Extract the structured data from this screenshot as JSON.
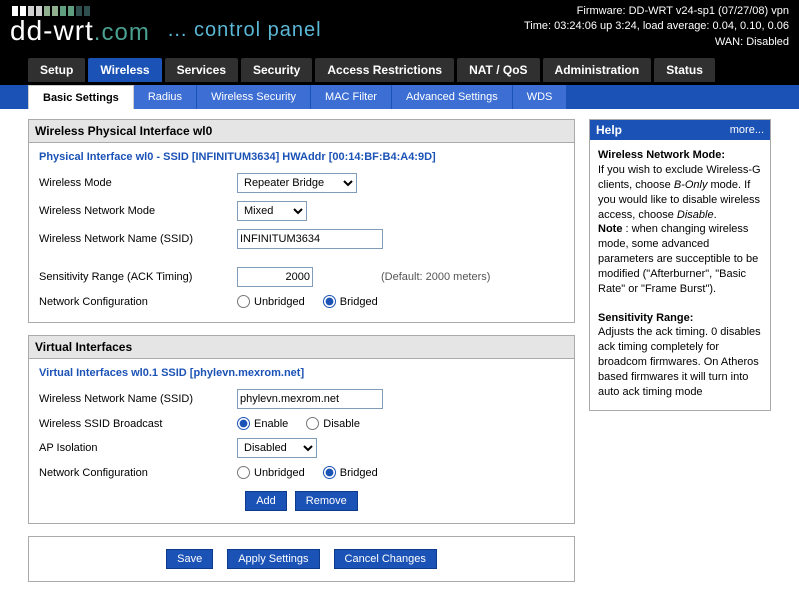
{
  "header": {
    "firmware": "Firmware: DD-WRT v24-sp1 (07/27/08) vpn",
    "time": "Time: 03:24:06 up 3:24, load average: 0.04, 0.10, 0.06",
    "wan": "WAN: Disabled",
    "control_panel": "... control panel"
  },
  "primary_tabs": [
    "Setup",
    "Wireless",
    "Services",
    "Security",
    "Access Restrictions",
    "NAT / QoS",
    "Administration",
    "Status"
  ],
  "primary_active": 1,
  "sub_tabs": [
    "Basic Settings",
    "Radius",
    "Wireless Security",
    "MAC Filter",
    "Advanced Settings",
    "WDS"
  ],
  "sub_active": 0,
  "phys": {
    "panel_title": "Wireless Physical Interface wl0",
    "section": "Physical Interface wl0 - SSID [INFINITUM3634] HWAddr [00:14:BF:B4:A4:9D]",
    "mode_label": "Wireless Mode",
    "mode_value": "Repeater Bridge",
    "netmode_label": "Wireless Network Mode",
    "netmode_value": "Mixed",
    "ssid_label": "Wireless Network Name (SSID)",
    "ssid_value": "INFINITUM3634",
    "ack_label": "Sensitivity Range (ACK Timing)",
    "ack_value": "2000",
    "ack_hint": "(Default: 2000 meters)",
    "netcfg_label": "Network Configuration",
    "unbridged": "Unbridged",
    "bridged": "Bridged"
  },
  "virt": {
    "panel_title": "Virtual Interfaces",
    "section": "Virtual Interfaces wl0.1 SSID [phylevn.mexrom.net]",
    "ssid_label": "Wireless Network Name (SSID)",
    "ssid_value": "phylevn.mexrom.net",
    "bcast_label": "Wireless SSID Broadcast",
    "enable": "Enable",
    "disable": "Disable",
    "ap_iso_label": "AP Isolation",
    "ap_iso_value": "Disabled",
    "netcfg_label": "Network Configuration",
    "add": "Add",
    "remove": "Remove"
  },
  "actions": {
    "save": "Save",
    "apply": "Apply Settings",
    "cancel": "Cancel Changes"
  },
  "help": {
    "title": "Help",
    "more": "more...",
    "h1": "Wireless Network Mode:",
    "p1a": "If you wish to exclude Wireless-G clients, choose ",
    "p1b": "B-Only",
    "p1c": " mode. If you would like to disable wireless access, choose ",
    "p1d": "Disable",
    "p1e": ".",
    "note_label": "Note",
    "note_body": " : when changing wireless mode, some advanced parameters are succeptible to be modified (\"Afterburner\", \"Basic Rate\" or \"Frame Burst\").",
    "h2": "Sensitivity Range:",
    "p2": "Adjusts the ack timing. 0 disables ack timing completely for broadcom firmwares. On Atheros based firmwares it will turn into auto ack timing mode"
  }
}
